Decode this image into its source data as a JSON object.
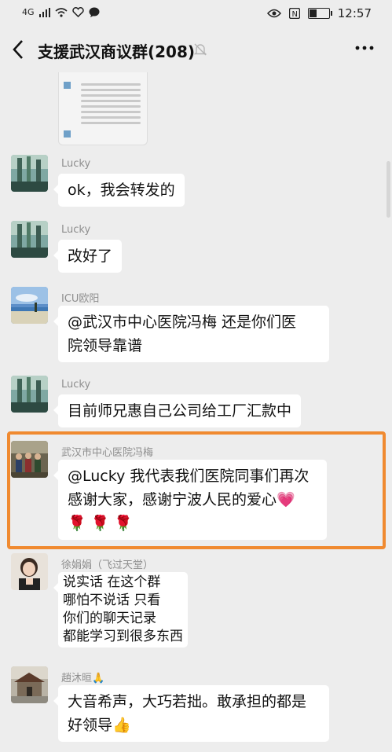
{
  "status_bar": {
    "signal": "4G",
    "time": "12:57",
    "icons": [
      "signal-icon",
      "wifi-icon",
      "heart-icon",
      "chat-icon",
      "eye-icon",
      "nfc-icon",
      "battery-icon"
    ]
  },
  "header": {
    "title": "支援武汉商议群(208)",
    "icons": [
      "back-icon",
      "mute-bell-icon",
      "more-icon"
    ]
  },
  "messages": [
    {
      "sender": "Lucky",
      "text": "ok，我会转发的"
    },
    {
      "sender": "Lucky",
      "text": "改好了"
    },
    {
      "sender": "ICU欧阳",
      "lines": [
        "@武汉市中心医院冯梅  还是你们医",
        "院领导靠谱"
      ]
    },
    {
      "sender": "Lucky",
      "text": "目前师兄惠自己公司给工厂汇款中"
    },
    {
      "sender": "武汉市中心医院冯梅",
      "lines": [
        "@Lucky 我代表我们医院同事们再次",
        "感谢大家，感谢宁波人民的爱心💗",
        "🌹 🌹 🌹"
      ],
      "highlighted": true
    },
    {
      "sender": "徐娟娟（飞过天堂）",
      "lines": [
        "说实话  在这个群",
        "哪怕不说话  只看",
        "你们的聊天记录",
        "都能学习到很多东西"
      ]
    },
    {
      "sender": "趙沐晅🙏",
      "lines": [
        "大音希声，大巧若拙。敢承担的都是",
        "好领导👍"
      ]
    }
  ],
  "colors": {
    "background": "#ededed",
    "bubble": "#ffffff",
    "highlight": "#f08a30",
    "sender_name": "#8e8e8e"
  }
}
